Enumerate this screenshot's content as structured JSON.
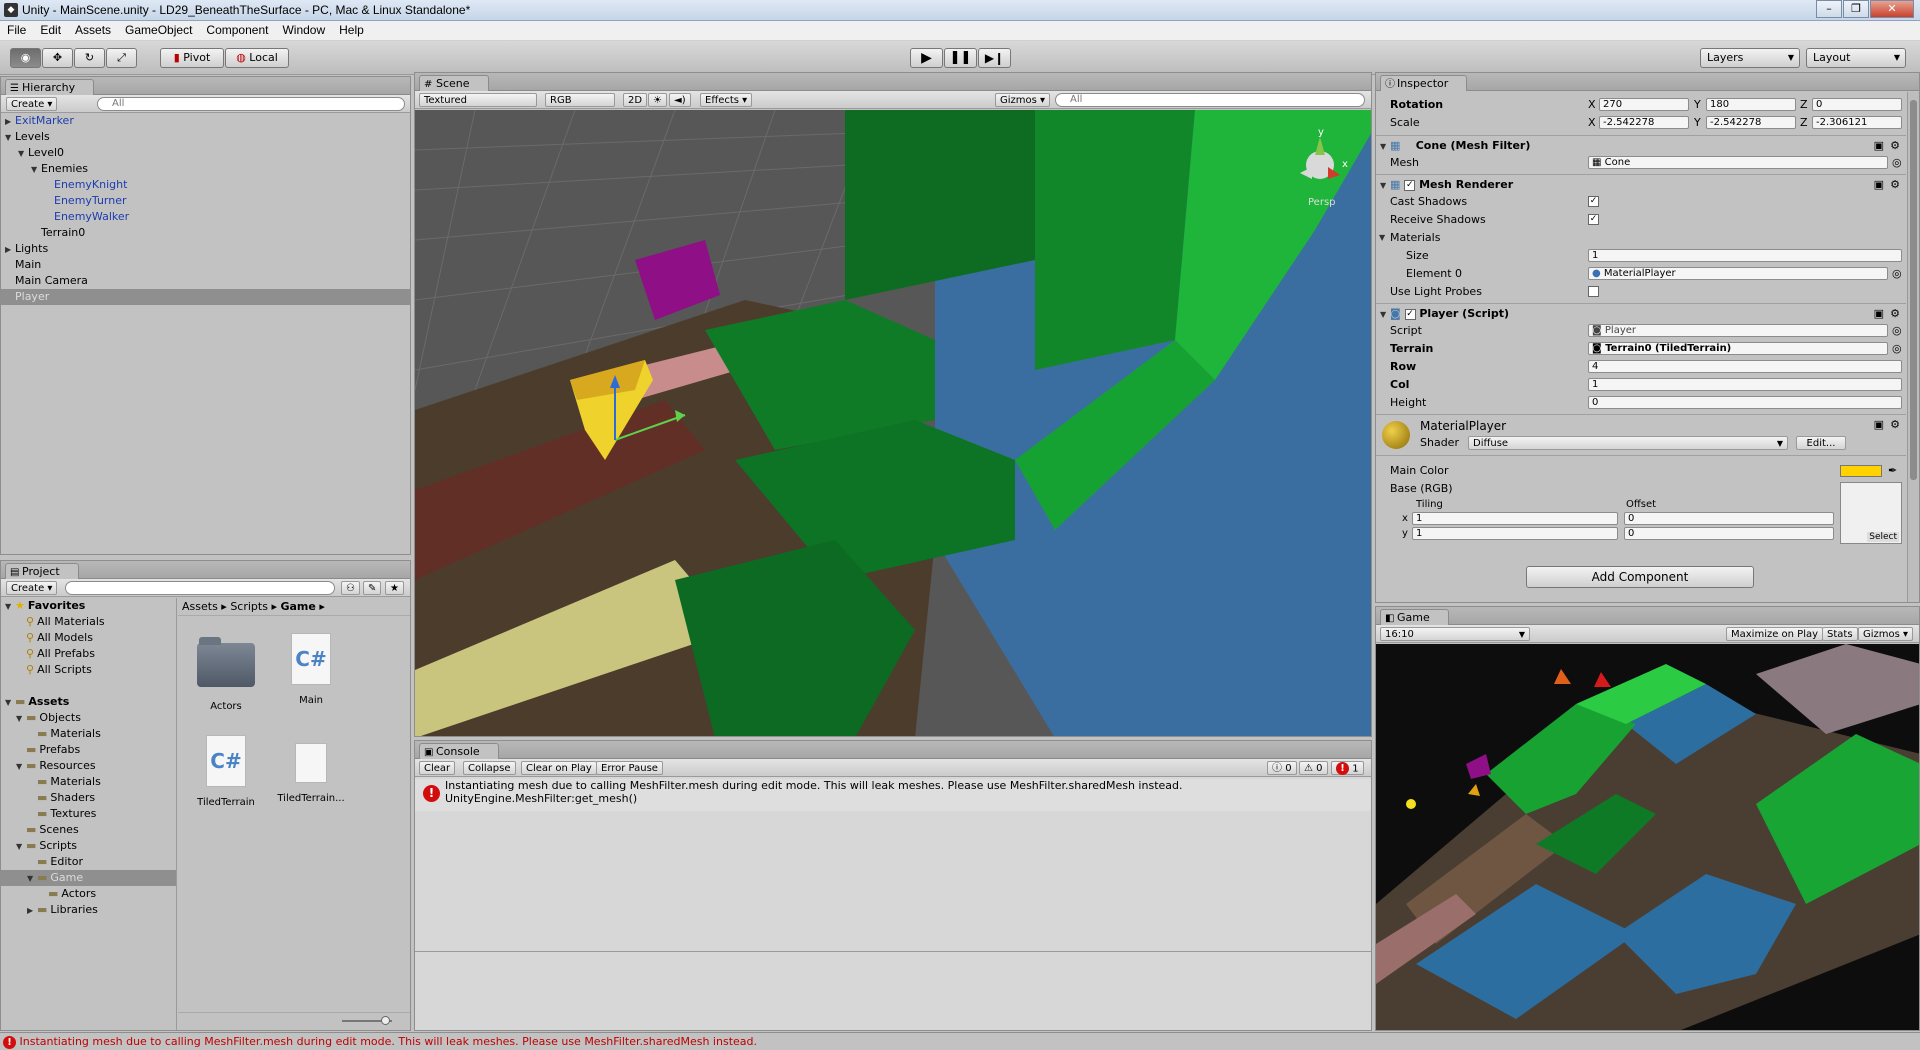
{
  "window": {
    "title": "Unity - MainScene.unity - LD29_BeneathTheSurface - PC, Mac & Linux Standalone*",
    "controls": [
      "–",
      "❐",
      "✕"
    ]
  },
  "menu": [
    "File",
    "Edit",
    "Assets",
    "GameObject",
    "Component",
    "Window",
    "Help"
  ],
  "toolbar": {
    "pivot": "Pivot",
    "local": "Local",
    "layers": "Layers",
    "layout": "Layout"
  },
  "hierarchy": {
    "tab": "Hierarchy",
    "create": "Create",
    "search_placeholder": "All",
    "items": [
      {
        "label": "ExitMarker",
        "depth": 0,
        "arrow": "▶",
        "blue": true
      },
      {
        "label": "Levels",
        "depth": 0,
        "arrow": "▼",
        "blue": false
      },
      {
        "label": "Level0",
        "depth": 1,
        "arrow": "▼",
        "blue": false
      },
      {
        "label": "Enemies",
        "depth": 2,
        "arrow": "▼",
        "blue": false
      },
      {
        "label": "EnemyKnight",
        "depth": 3,
        "arrow": "",
        "blue": true
      },
      {
        "label": "EnemyTurner",
        "depth": 3,
        "arrow": "",
        "blue": true
      },
      {
        "label": "EnemyWalker",
        "depth": 3,
        "arrow": "",
        "blue": true
      },
      {
        "label": "Terrain0",
        "depth": 2,
        "arrow": "",
        "blue": false
      },
      {
        "label": "Lights",
        "depth": 0,
        "arrow": "▶",
        "blue": false
      },
      {
        "label": "Main",
        "depth": 0,
        "arrow": "",
        "blue": false
      },
      {
        "label": "Main Camera",
        "depth": 0,
        "arrow": "",
        "blue": false
      },
      {
        "label": "Player",
        "depth": 0,
        "arrow": "",
        "blue": false,
        "selected": true
      }
    ]
  },
  "project": {
    "tab": "Project",
    "create": "Create",
    "breadcrumb": [
      "Assets",
      "Scripts",
      "Game"
    ],
    "favorites_label": "Favorites",
    "favorites": [
      "All Materials",
      "All Models",
      "All Prefabs",
      "All Scripts"
    ],
    "assets_label": "Assets",
    "tree": [
      {
        "label": "Objects",
        "depth": 1,
        "arrow": "▼"
      },
      {
        "label": "Materials",
        "depth": 2,
        "arrow": ""
      },
      {
        "label": "Prefabs",
        "depth": 1,
        "arrow": ""
      },
      {
        "label": "Resources",
        "depth": 1,
        "arrow": "▼"
      },
      {
        "label": "Materials",
        "depth": 2,
        "arrow": ""
      },
      {
        "label": "Shaders",
        "depth": 2,
        "arrow": ""
      },
      {
        "label": "Textures",
        "depth": 2,
        "arrow": ""
      },
      {
        "label": "Scenes",
        "depth": 1,
        "arrow": ""
      },
      {
        "label": "Scripts",
        "depth": 1,
        "arrow": "▼"
      },
      {
        "label": "Editor",
        "depth": 2,
        "arrow": ""
      },
      {
        "label": "Game",
        "depth": 2,
        "arrow": "▼",
        "selected": true
      },
      {
        "label": "Actors",
        "depth": 3,
        "arrow": ""
      },
      {
        "label": "Libraries",
        "depth": 2,
        "arrow": "▶"
      }
    ],
    "files": [
      {
        "label": "Actors",
        "kind": "folder"
      },
      {
        "label": "Main",
        "kind": "cs"
      },
      {
        "label": "TiledTerrain",
        "kind": "cs"
      },
      {
        "label": "TiledTerrain...",
        "kind": "file"
      }
    ]
  },
  "scene": {
    "tab": "Scene",
    "shading": "Textured",
    "render": "RGB",
    "mode2d": "2D",
    "effects": "Effects",
    "gizmos": "Gizmos",
    "search_placeholder": "All",
    "persp": "Persp",
    "axis_y": "y",
    "axis_x": "x"
  },
  "console": {
    "tab": "Console",
    "buttons": [
      "Clear",
      "Collapse",
      "Clear on Play",
      "Error Pause"
    ],
    "counts": {
      "info": "0",
      "warn": "0",
      "error": "1"
    },
    "message_line1": "Instantiating mesh due to calling MeshFilter.mesh during edit mode. This will leak meshes. Please use MeshFilter.sharedMesh instead.",
    "message_line2": "UnityEngine.MeshFilter:get_mesh()"
  },
  "inspector": {
    "tab": "Inspector",
    "rotation_label": "Rotation",
    "rotation": {
      "x": "270",
      "y": "180",
      "z": "0"
    },
    "scale_label": "Scale",
    "scale": {
      "x": "-2.542278",
      "y": "-2.542278",
      "z": "-2.306121"
    },
    "mesh_filter": {
      "header": "Cone (Mesh Filter)",
      "mesh_label": "Mesh",
      "mesh": "Cone"
    },
    "mesh_renderer": {
      "header": "Mesh Renderer",
      "cast_shadows": "Cast Shadows",
      "receive_shadows": "Receive Shadows",
      "materials": "Materials",
      "size_label": "Size",
      "size": "1",
      "element0_label": "Element 0",
      "element0": "MaterialPlayer",
      "light_probes": "Use Light Probes"
    },
    "player_script": {
      "header": "Player (Script)",
      "script_label": "Script",
      "script": "Player",
      "terrain_label": "Terrain",
      "terrain": "Terrain0 (TiledTerrain)",
      "row_label": "Row",
      "row": "4",
      "col_label": "Col",
      "col": "1",
      "height_label": "Height",
      "height": "0"
    },
    "material": {
      "name": "MaterialPlayer",
      "shader_label": "Shader",
      "shader": "Diffuse",
      "edit": "Edit...",
      "main_color_label": "Main Color",
      "main_color": "#ffd200",
      "base_label": "Base (RGB)",
      "tiling_label": "Tiling",
      "offset_label": "Offset",
      "tiling_x": "1",
      "tiling_y": "1",
      "offset_x": "0",
      "offset_y": "0",
      "select": "Select"
    },
    "add_component": "Add Component"
  },
  "game": {
    "tab": "Game",
    "aspect": "16:10",
    "maximize": "Maximize on Play",
    "stats": "Stats",
    "gizmos": "Gizmos"
  },
  "status": {
    "message": "Instantiating mesh due to calling MeshFilter.mesh during edit mode. This will leak meshes. Please use MeshFilter.sharedMesh instead."
  }
}
